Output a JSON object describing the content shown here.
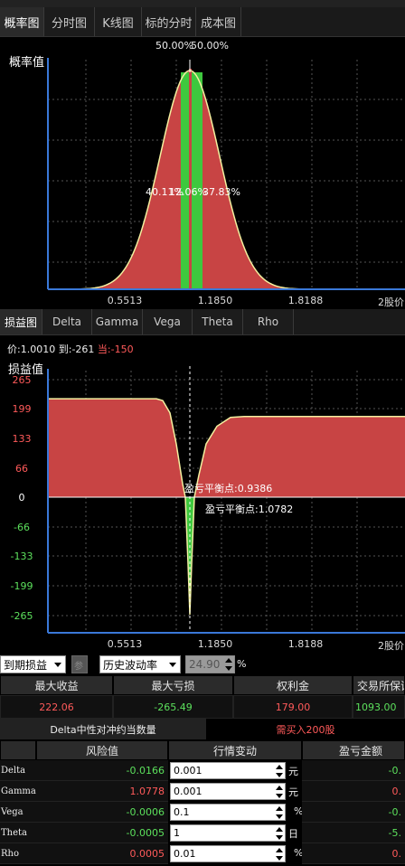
{
  "top_tabs": [
    "概率图",
    "分时图",
    "K线图",
    "标的分时",
    "成本图"
  ],
  "prob_chart": {
    "ylabel": "概率值",
    "top_label_left": "50.00%",
    "top_label_right": "50.00%",
    "region_labels": [
      "40.11%",
      "12.06%",
      "37.83%"
    ],
    "x_ticks": [
      "0.5513",
      "1.1850",
      "1.8188",
      "2"
    ],
    "x_unit": "股价"
  },
  "greek_tabs": [
    "损益图",
    "Delta",
    "Gamma",
    "Vega",
    "Theta",
    "Rho"
  ],
  "info_line": {
    "price_label": "价:",
    "price_value": "1.0010",
    "exp_label": "到:",
    "exp_value": "-261",
    "cur_label": "当:",
    "cur_value": "-150"
  },
  "pnl_chart": {
    "ylabel": "损益值",
    "y_ticks": [
      "265",
      "199",
      "133",
      "66",
      "0",
      "-66",
      "-133",
      "-199",
      "-265"
    ],
    "x_ticks": [
      "0.5513",
      "1.1850",
      "1.8188",
      "2"
    ],
    "x_unit": "股价",
    "breakeven_1": "盈亏平衡点:0.9386",
    "breakeven_2": "盈亏平衡点:1.0782"
  },
  "chart_data": [
    {
      "type": "area",
      "ylabel": "概率值",
      "xlabel": "股价",
      "x_ticks": [
        0.5513,
        1.185,
        1.8188
      ],
      "segment_labels": [
        "40.11%",
        "12.06%",
        "37.83%"
      ],
      "top_labels": [
        "50.00%",
        "50.00%"
      ],
      "highlight_range": [
        0.9386,
        1.0782
      ]
    },
    {
      "type": "area",
      "ylabel": "损益值",
      "xlabel": "股价",
      "ylim": [
        -265,
        265
      ],
      "y_ticks": [
        265,
        199,
        133,
        66,
        0,
        -66,
        -133,
        -199,
        -265
      ],
      "x_ticks": [
        0.5513,
        1.185,
        1.8188
      ],
      "breakevens": [
        0.9386,
        1.0782
      ],
      "max_gain": 222.06,
      "max_loss": -265.49
    }
  ],
  "controls": {
    "mode_select": "到期损益",
    "param_button": "参",
    "vol_select": "历史波动率",
    "vol_value": "24.90",
    "vol_unit": "%"
  },
  "stats": {
    "headers": [
      "最大收益",
      "最大亏损",
      "权利金",
      "交易所保证"
    ],
    "values": [
      "222.06",
      "-265.49",
      "179.00",
      "1093.00"
    ]
  },
  "hedge": {
    "label": "Delta中性对冲约当数量",
    "value": "需买入200股"
  },
  "risk_table": {
    "headers": [
      "风险值",
      "行情变动",
      "盈亏金额"
    ],
    "rows": [
      {
        "name": "Delta",
        "risk": "-0.0166",
        "change": "0.001",
        "unit": "元",
        "pnl": "-0."
      },
      {
        "name": "Gamma",
        "risk": "1.0778",
        "change": "0.001",
        "unit": "元",
        "pnl": "0."
      },
      {
        "name": "Vega",
        "risk": "-0.0006",
        "change": "0.1",
        "unit": "%",
        "pnl": "-0."
      },
      {
        "name": "Theta",
        "risk": "-0.0005",
        "change": "1",
        "unit": "日",
        "pnl": "-5."
      },
      {
        "name": "Rho",
        "risk": "0.0005",
        "change": "0.01",
        "unit": "%",
        "pnl": "0."
      }
    ]
  },
  "colors": {
    "loss_green": "#3ec83e",
    "profit_red": "#c84444",
    "curve": "#f3f0a0",
    "value_red": "#ff5a5a",
    "value_green": "#5ce05c"
  }
}
